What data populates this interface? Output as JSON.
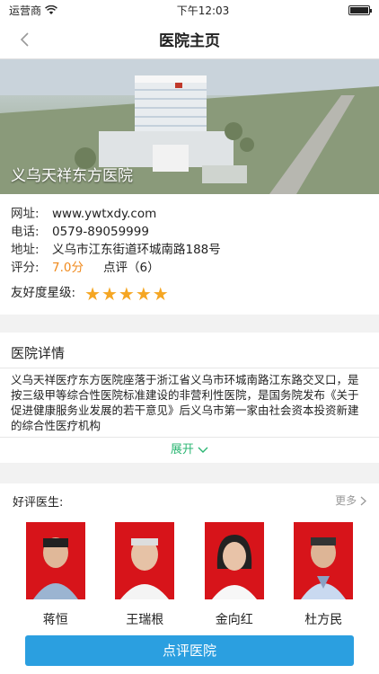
{
  "status": {
    "carrier": "运营商",
    "time": "下午12:03"
  },
  "nav": {
    "title": "医院主页"
  },
  "hero": {
    "name": "义乌天祥东方医院"
  },
  "info": {
    "website_label": "网址:",
    "website": "www.ywtxdy.com",
    "phone_label": "电话:",
    "phone": "0579-89059999",
    "address_label": "地址:",
    "address": "义乌市江东街道环城南路188号",
    "score_label": "评分:",
    "score": "7.0分",
    "reviews": "点评（6）",
    "friendliness_label": "友好度星级:",
    "stars": "★★★★★",
    "star_rating": 5
  },
  "detail": {
    "title": "医院详情",
    "body": "义乌天祥医疗东方医院座落于浙江省义乌市环城南路江东路交叉口，是按三级甲等综合性医院标准建设的非营利性医院，是国务院发布《关于促进健康服务业发展的若干意见》后义乌市第一家由社会资本投资新建的综合性医疗机构",
    "expand": "展开"
  },
  "doctors": {
    "title": "好评医生:",
    "more": "更多",
    "list": [
      {
        "name": "蒋恒"
      },
      {
        "name": "王瑞根"
      },
      {
        "name": "金向红"
      },
      {
        "name": "杜方民"
      }
    ]
  },
  "action": {
    "label": "点评医院"
  },
  "colors": {
    "accent": "#2b9fe0",
    "rating": "#f08a1d",
    "star": "#f5a623",
    "expand": "#2bb673"
  }
}
